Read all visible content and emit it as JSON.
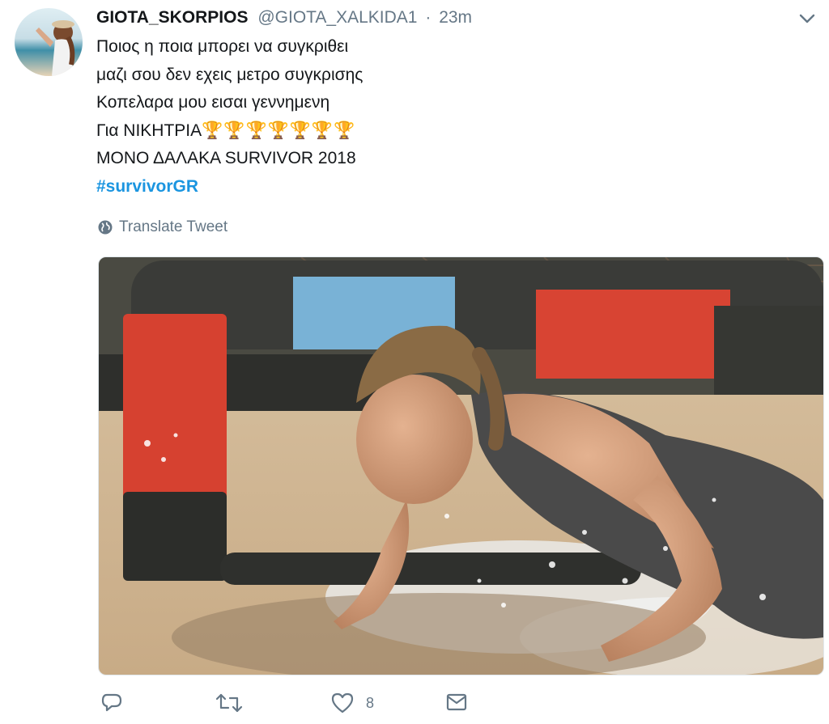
{
  "tweet": {
    "author_name": "GIOTA_SKORPIOS",
    "author_handle": "@GIOTA_XALKIDA1",
    "separator": "·",
    "time": "23m",
    "lines": [
      "Ποιος η ποια μπορει να συγκριθει",
      "μαζι σου δεν εχεις μετρο συγκρισης",
      "Κοπελαρα μου εισαι γεννημενη",
      "Για ΝΙΚΗΤΡΙΑ",
      "ΜΟΝΟ ΔΑΛΑΚΑ SURVIVOR 2018"
    ],
    "trophies": "🏆🏆🏆🏆🏆🏆🏆",
    "hashtag": "#survivorGR",
    "translate_label": "Translate Tweet"
  },
  "actions": {
    "reply_icon": "reply-icon",
    "retweet_icon": "retweet-icon",
    "like_icon": "heart-icon",
    "like_count": "8",
    "dm_icon": "envelope-icon"
  },
  "colors": {
    "link": "#1b95e0",
    "muted": "#657786",
    "text": "#14171a"
  }
}
